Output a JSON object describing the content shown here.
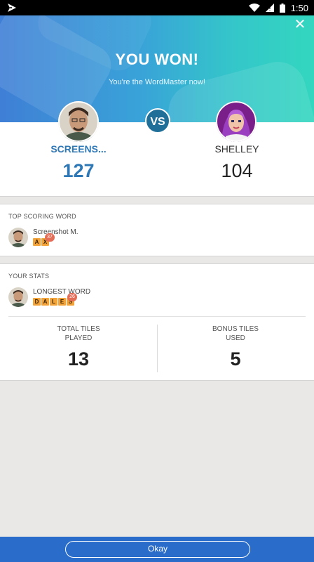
{
  "status_bar": {
    "time": "1:50"
  },
  "hero": {
    "title": "YOU WON!",
    "subtitle": "You're the WordMaster now!"
  },
  "match": {
    "vs": "VS",
    "player_left": {
      "name": "SCREENS...",
      "score": "127"
    },
    "player_right": {
      "name": "SHELLEY",
      "score": "104"
    }
  },
  "top_scoring_word": {
    "label": "TOP SCORING WORD",
    "player": "Screenshot M.",
    "tiles": [
      "A",
      "X"
    ],
    "points": "37"
  },
  "your_stats": {
    "label": "YOUR STATS",
    "longest_word_label": "LONGEST WORD",
    "tiles": [
      "D",
      "A",
      "L",
      "E",
      "S"
    ],
    "points": "26",
    "total_tiles_label_1": "TOTAL TILES",
    "total_tiles_label_2": "PLAYED",
    "total_tiles_value": "13",
    "bonus_tiles_label_1": "BONUS TILES",
    "bonus_tiles_label_2": "USED",
    "bonus_tiles_value": "5"
  },
  "footer": {
    "okay_label": "Okay"
  },
  "colors": {
    "accent": "#2f78b6",
    "footer": "#2a6cc9",
    "tile": "#f2a33a",
    "tile_badge": "#e46d57"
  }
}
